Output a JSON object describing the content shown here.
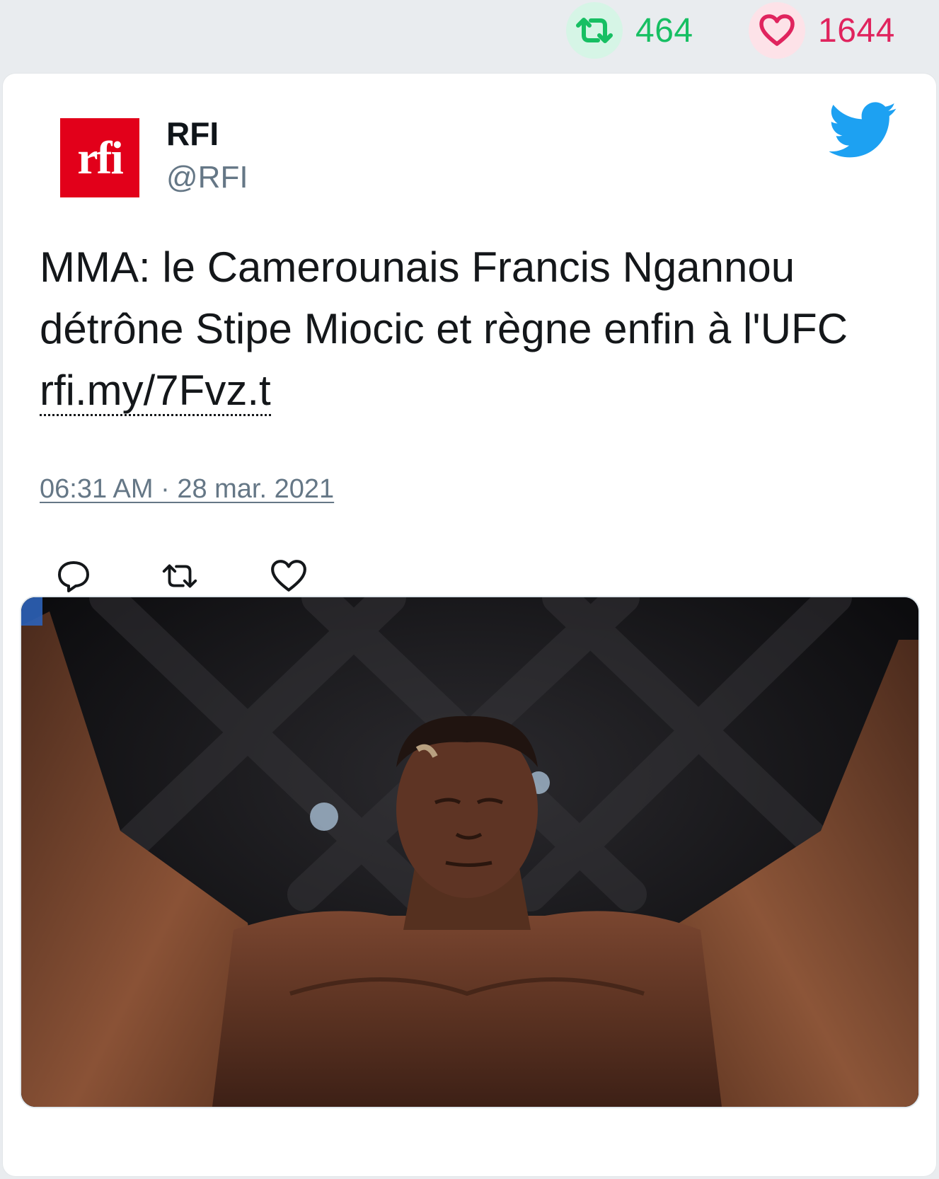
{
  "stats": {
    "retweet_count": "464",
    "like_count": "1644",
    "colors": {
      "retweet": "#17bf63",
      "like": "#e0245e"
    }
  },
  "tweet": {
    "author_name": "RFI",
    "author_handle": "@RFI",
    "avatar_icon": "rfi-logo",
    "avatar_logo_text": "rfi",
    "text_main": "MMA: le Camerounais Francis Ngannou détrône Stipe Miocic et règne enfin à l'UFC ",
    "link_text": "rfi.my/7Fvz.t",
    "timestamp": "06:31 AM · 28 mar. 2021",
    "actions": [
      "reply-icon",
      "retweet-icon",
      "like-icon"
    ],
    "platform_icon": "twitter-bird-icon",
    "colors": {
      "brand": "#1da1f2",
      "text": "#14171a",
      "muted": "#657786",
      "logo_red": "#e2001a"
    }
  }
}
